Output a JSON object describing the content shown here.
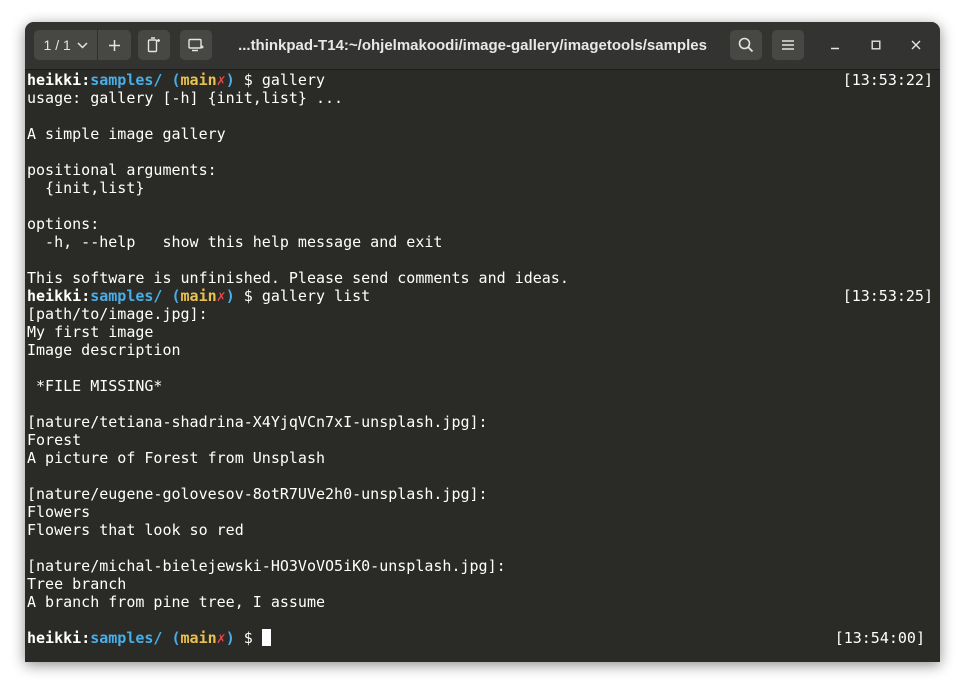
{
  "window": {
    "title": "...thinkpad-T14:~/ohjelmakoodi/image-gallery/imagetools/samples",
    "tab_counter": "1 / 1",
    "icons": {
      "tab_dropdown": "chevron-down-icon",
      "add_tab": "plus-icon",
      "new_tab": "new-tab-icon",
      "new_window": "new-window-icon",
      "search": "search-icon",
      "menu": "hamburger-menu-icon",
      "minimize": "minimize-icon",
      "maximize": "maximize-icon",
      "close": "close-icon"
    }
  },
  "prompt": {
    "user": "heikki",
    "colon": ":",
    "dir": "samples/",
    "paren_open": "(",
    "branch": "main",
    "dirty": "✗",
    "paren_close": ")",
    "symbol": " $ "
  },
  "colors": {
    "background": "#2a2a26",
    "text": "#ffffff",
    "prompt_dir": "#4aaee6",
    "prompt_branch": "#e8c14f",
    "prompt_dirty": "#e5484d"
  },
  "terminal": {
    "cmd1": "gallery",
    "ts1": "[13:53:22]",
    "help_usage": "usage: gallery [-h] {init,list} ...",
    "help_blank1": "",
    "help_desc": "A simple image gallery",
    "help_blank2": "",
    "help_positional": "positional arguments:",
    "help_choices": "  {init,list}",
    "help_blank3": "",
    "help_options": "options:",
    "help_h": "  -h, --help   show this help message and exit",
    "help_blank4": "",
    "help_footer": "This software is unfinished. Please send comments and ideas.",
    "cmd2": "gallery list",
    "ts2": "[13:53:25]",
    "list": [
      "[path/to/image.jpg]:",
      "My first image",
      "Image description",
      "",
      " *FILE MISSING*",
      "",
      "[nature/tetiana-shadrina-X4YjqVCn7xI-unsplash.jpg]:",
      "Forest",
      "A picture of Forest from Unsplash",
      "",
      "[nature/eugene-golovesov-8otR7UVe2h0-unsplash.jpg]:",
      "Flowers",
      "Flowers that look so red",
      "",
      "[nature/michal-bielejewski-HO3VoVO5iK0-unsplash.jpg]:",
      "Tree branch",
      "A branch from pine tree, I assume",
      ""
    ],
    "cmd3": "",
    "ts3": "[13:54:00]"
  }
}
